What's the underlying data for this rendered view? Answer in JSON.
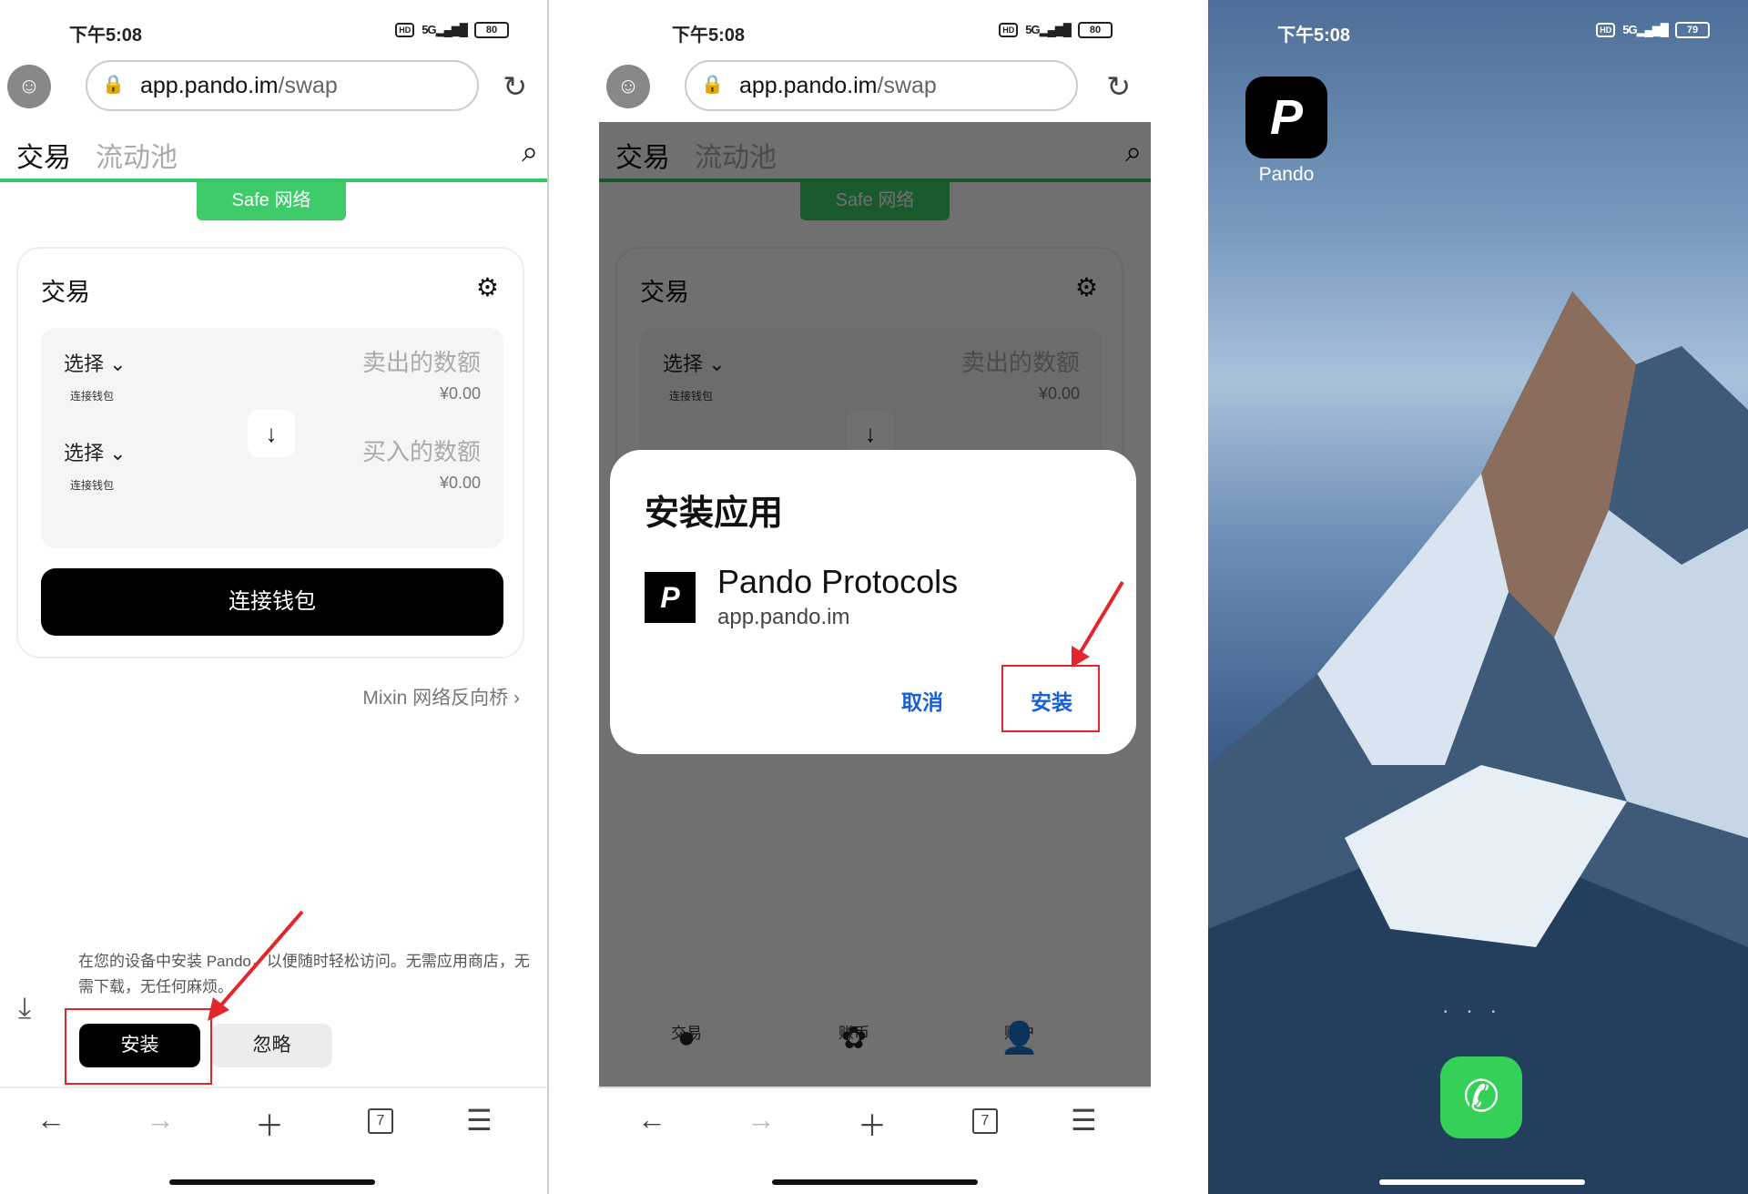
{
  "status": {
    "time": "下午5:08",
    "hd": "HD",
    "signal": "5G",
    "battery": "80",
    "battery3": "79"
  },
  "browser": {
    "url_host": "app.pando.im",
    "url_path": "/swap"
  },
  "app": {
    "tab_trade": "交易",
    "tab_pool": "流动池",
    "safe_banner": "Safe 网络",
    "card_title": "交易",
    "select": "选择",
    "sell_amount": "卖出的数额",
    "buy_amount": "买入的数额",
    "wallet_small": "连接钱包",
    "price_zero": "¥0.00",
    "connect_button": "连接钱包",
    "mixin_link": "Mixin 网络反向桥 ›"
  },
  "install_prompt": {
    "message": "在您的设备中安装 Pando，以便随时轻松访问。无需应用商店，无需下载，无任何麻烦。",
    "install": "安装",
    "ignore": "忽略"
  },
  "dialog": {
    "title": "安装应用",
    "app_name": "Pando Protocols",
    "app_domain": "app.pando.im",
    "cancel": "取消",
    "install": "安装"
  },
  "tabbar": {
    "trade": "交易",
    "mint": "赚币",
    "account": "账户"
  },
  "bottom_nav": {
    "tab_count": "7"
  },
  "home": {
    "app_label": "Pando"
  },
  "colors": {
    "accent_green": "#35c46a",
    "link_blue": "#1a5fd6",
    "highlight_red": "#e2262b"
  }
}
